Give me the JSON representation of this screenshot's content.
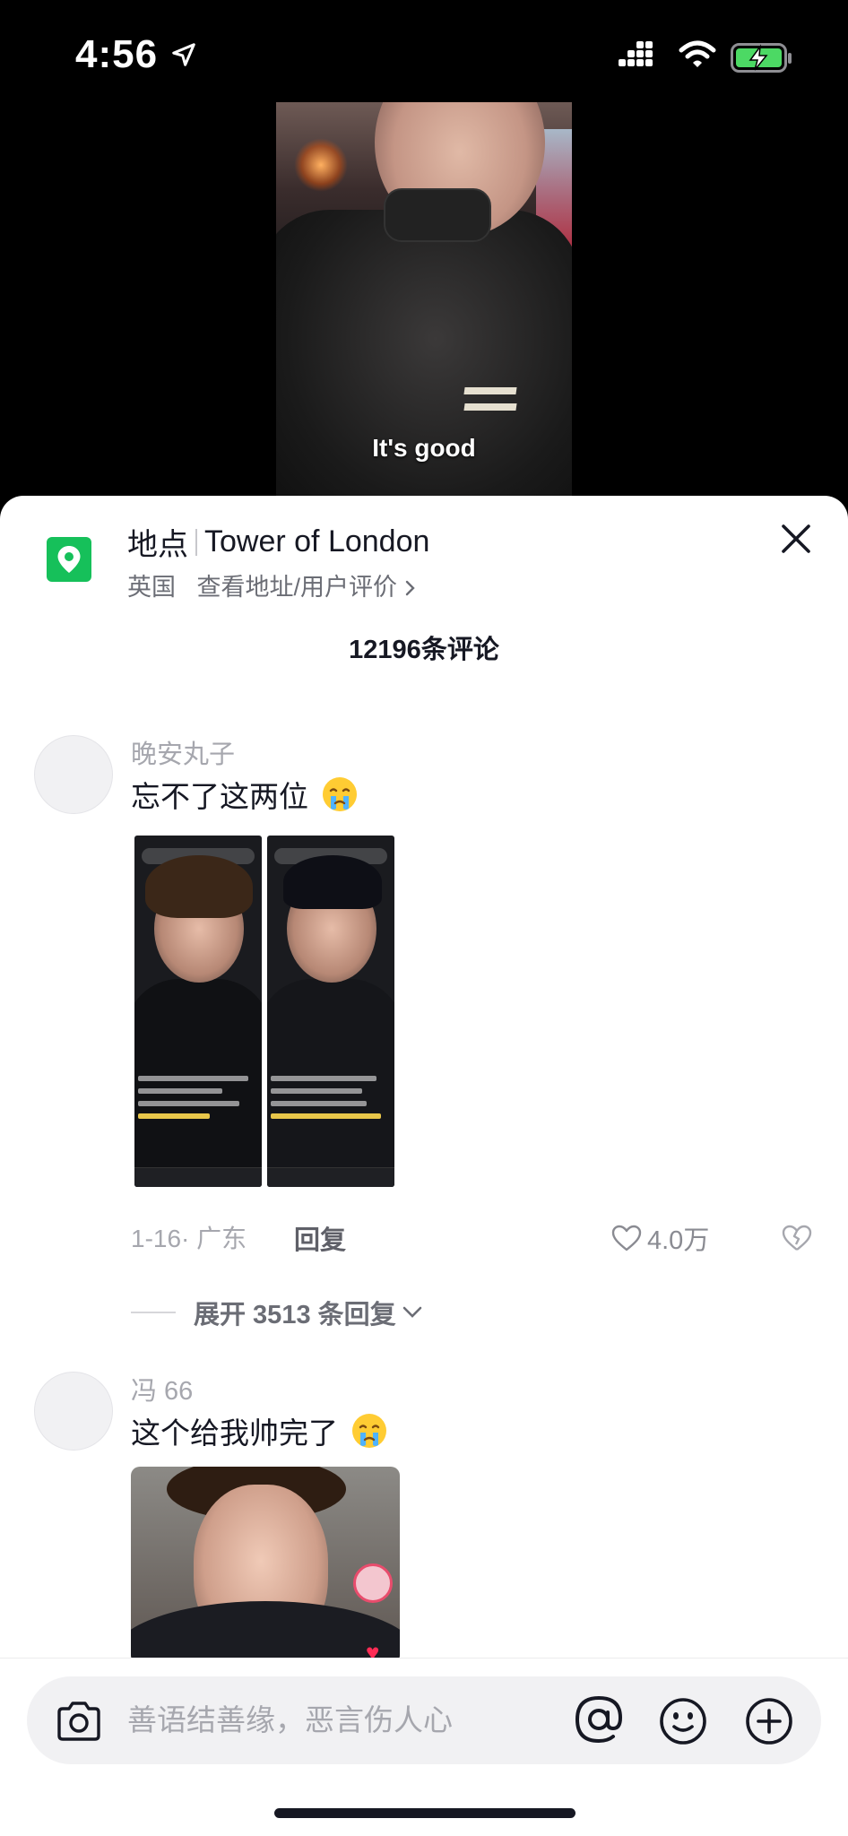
{
  "status_bar": {
    "time": "4:56",
    "icons": [
      "location-arrow-icon",
      "signal-icon",
      "wifi-icon",
      "battery-charging-icon"
    ],
    "battery_color": "#4cd964"
  },
  "video": {
    "subtitle": "It's good"
  },
  "location": {
    "label": "地点",
    "name": "Tower of London",
    "country": "英国",
    "link_text": "查看地址/用户评价",
    "pin_color": "#16c05a"
  },
  "comments_header": {
    "count_text": "12196条评论"
  },
  "comments": [
    {
      "username": "晚安丸子",
      "text": "忘不了这两位",
      "emoji": "crying-face",
      "meta": "1-16· 广东",
      "reply_label": "回复",
      "likes": "4.0万",
      "expand_text": "展开 3513 条回复"
    },
    {
      "username": "冯 66",
      "text": "这个给我帅完了",
      "emoji": "crying-face"
    }
  ],
  "input": {
    "placeholder": "善语结善缘，恶言伤人心",
    "icons": [
      "camera-icon",
      "at-icon",
      "emoji-icon",
      "plus-circle-icon"
    ]
  }
}
